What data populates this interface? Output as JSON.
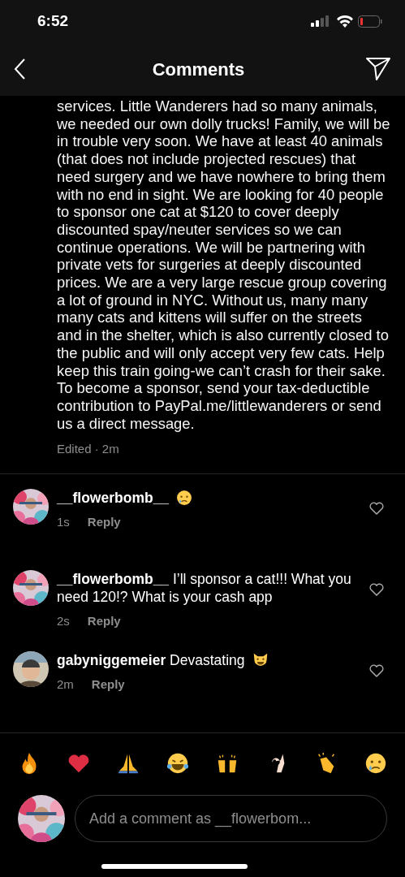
{
  "status_bar": {
    "time": "6:52"
  },
  "header": {
    "title": "Comments"
  },
  "caption": {
    "text": "services. Little Wanderers had so many animals, we needed our own dolly trucks! Family, we will be in trouble very soon. We have at least 40 animals (that does not include projected rescues) that need surgery and we have nowhere to bring them with no end in sight. We are looking for 40 people to sponsor one cat at $120 to cover deeply discounted spay/neuter services so we can continue operations. We will be partnering with private vets for surgeries at deeply discounted prices. We are a very large rescue group covering a lot of ground in NYC. Without us, many many many cats and kittens will suffer on the streets and in the shelter, which is also currently closed to the public and will only accept very few cats. Help keep this train going-we can’t crash for their sake. To become a sponsor, send your tax-deductible contribution to PayPal.me/littlewanderers or send us a direct message.",
    "meta": "Edited · 2m"
  },
  "comments": [
    {
      "username": "__flowerbomb__",
      "emoji": {
        "kind": "crying"
      },
      "time": "1s",
      "reply": "Reply"
    },
    {
      "username": "__flowerbomb__",
      "text": "I’ll sponsor a cat!!! What you need 120!? What is your cash app",
      "time": "2s",
      "reply": "Reply"
    },
    {
      "username": "gabyniggemeier",
      "text": "Devastating",
      "emoji": {
        "kind": "cat"
      },
      "time": "2m",
      "reply": "Reply"
    }
  ],
  "reactions": [
    {
      "kind": "fire"
    },
    {
      "kind": "heart"
    },
    {
      "kind": "pray"
    },
    {
      "kind": "laugh"
    },
    {
      "kind": "raised"
    },
    {
      "kind": "ok"
    },
    {
      "kind": "clap"
    },
    {
      "kind": "crying"
    }
  ],
  "composer": {
    "placeholder": "Add a comment as __flowerbom..."
  }
}
